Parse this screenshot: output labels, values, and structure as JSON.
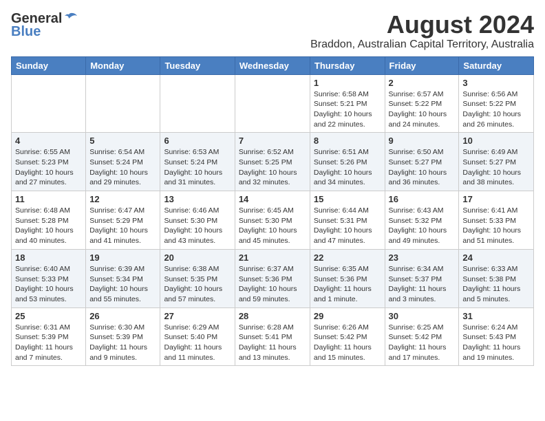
{
  "header": {
    "logo_general": "General",
    "logo_blue": "Blue",
    "title": "August 2024",
    "subtitle": "Braddon, Australian Capital Territory, Australia"
  },
  "days_of_week": [
    "Sunday",
    "Monday",
    "Tuesday",
    "Wednesday",
    "Thursday",
    "Friday",
    "Saturday"
  ],
  "weeks": [
    [
      {
        "day": "",
        "info": ""
      },
      {
        "day": "",
        "info": ""
      },
      {
        "day": "",
        "info": ""
      },
      {
        "day": "",
        "info": ""
      },
      {
        "day": "1",
        "info": "Sunrise: 6:58 AM\nSunset: 5:21 PM\nDaylight: 10 hours\nand 22 minutes."
      },
      {
        "day": "2",
        "info": "Sunrise: 6:57 AM\nSunset: 5:22 PM\nDaylight: 10 hours\nand 24 minutes."
      },
      {
        "day": "3",
        "info": "Sunrise: 6:56 AM\nSunset: 5:22 PM\nDaylight: 10 hours\nand 26 minutes."
      }
    ],
    [
      {
        "day": "4",
        "info": "Sunrise: 6:55 AM\nSunset: 5:23 PM\nDaylight: 10 hours\nand 27 minutes."
      },
      {
        "day": "5",
        "info": "Sunrise: 6:54 AM\nSunset: 5:24 PM\nDaylight: 10 hours\nand 29 minutes."
      },
      {
        "day": "6",
        "info": "Sunrise: 6:53 AM\nSunset: 5:24 PM\nDaylight: 10 hours\nand 31 minutes."
      },
      {
        "day": "7",
        "info": "Sunrise: 6:52 AM\nSunset: 5:25 PM\nDaylight: 10 hours\nand 32 minutes."
      },
      {
        "day": "8",
        "info": "Sunrise: 6:51 AM\nSunset: 5:26 PM\nDaylight: 10 hours\nand 34 minutes."
      },
      {
        "day": "9",
        "info": "Sunrise: 6:50 AM\nSunset: 5:27 PM\nDaylight: 10 hours\nand 36 minutes."
      },
      {
        "day": "10",
        "info": "Sunrise: 6:49 AM\nSunset: 5:27 PM\nDaylight: 10 hours\nand 38 minutes."
      }
    ],
    [
      {
        "day": "11",
        "info": "Sunrise: 6:48 AM\nSunset: 5:28 PM\nDaylight: 10 hours\nand 40 minutes."
      },
      {
        "day": "12",
        "info": "Sunrise: 6:47 AM\nSunset: 5:29 PM\nDaylight: 10 hours\nand 41 minutes."
      },
      {
        "day": "13",
        "info": "Sunrise: 6:46 AM\nSunset: 5:30 PM\nDaylight: 10 hours\nand 43 minutes."
      },
      {
        "day": "14",
        "info": "Sunrise: 6:45 AM\nSunset: 5:30 PM\nDaylight: 10 hours\nand 45 minutes."
      },
      {
        "day": "15",
        "info": "Sunrise: 6:44 AM\nSunset: 5:31 PM\nDaylight: 10 hours\nand 47 minutes."
      },
      {
        "day": "16",
        "info": "Sunrise: 6:43 AM\nSunset: 5:32 PM\nDaylight: 10 hours\nand 49 minutes."
      },
      {
        "day": "17",
        "info": "Sunrise: 6:41 AM\nSunset: 5:33 PM\nDaylight: 10 hours\nand 51 minutes."
      }
    ],
    [
      {
        "day": "18",
        "info": "Sunrise: 6:40 AM\nSunset: 5:33 PM\nDaylight: 10 hours\nand 53 minutes."
      },
      {
        "day": "19",
        "info": "Sunrise: 6:39 AM\nSunset: 5:34 PM\nDaylight: 10 hours\nand 55 minutes."
      },
      {
        "day": "20",
        "info": "Sunrise: 6:38 AM\nSunset: 5:35 PM\nDaylight: 10 hours\nand 57 minutes."
      },
      {
        "day": "21",
        "info": "Sunrise: 6:37 AM\nSunset: 5:36 PM\nDaylight: 10 hours\nand 59 minutes."
      },
      {
        "day": "22",
        "info": "Sunrise: 6:35 AM\nSunset: 5:36 PM\nDaylight: 11 hours\nand 1 minute."
      },
      {
        "day": "23",
        "info": "Sunrise: 6:34 AM\nSunset: 5:37 PM\nDaylight: 11 hours\nand 3 minutes."
      },
      {
        "day": "24",
        "info": "Sunrise: 6:33 AM\nSunset: 5:38 PM\nDaylight: 11 hours\nand 5 minutes."
      }
    ],
    [
      {
        "day": "25",
        "info": "Sunrise: 6:31 AM\nSunset: 5:39 PM\nDaylight: 11 hours\nand 7 minutes."
      },
      {
        "day": "26",
        "info": "Sunrise: 6:30 AM\nSunset: 5:39 PM\nDaylight: 11 hours\nand 9 minutes."
      },
      {
        "day": "27",
        "info": "Sunrise: 6:29 AM\nSunset: 5:40 PM\nDaylight: 11 hours\nand 11 minutes."
      },
      {
        "day": "28",
        "info": "Sunrise: 6:28 AM\nSunset: 5:41 PM\nDaylight: 11 hours\nand 13 minutes."
      },
      {
        "day": "29",
        "info": "Sunrise: 6:26 AM\nSunset: 5:42 PM\nDaylight: 11 hours\nand 15 minutes."
      },
      {
        "day": "30",
        "info": "Sunrise: 6:25 AM\nSunset: 5:42 PM\nDaylight: 11 hours\nand 17 minutes."
      },
      {
        "day": "31",
        "info": "Sunrise: 6:24 AM\nSunset: 5:43 PM\nDaylight: 11 hours\nand 19 minutes."
      }
    ]
  ]
}
